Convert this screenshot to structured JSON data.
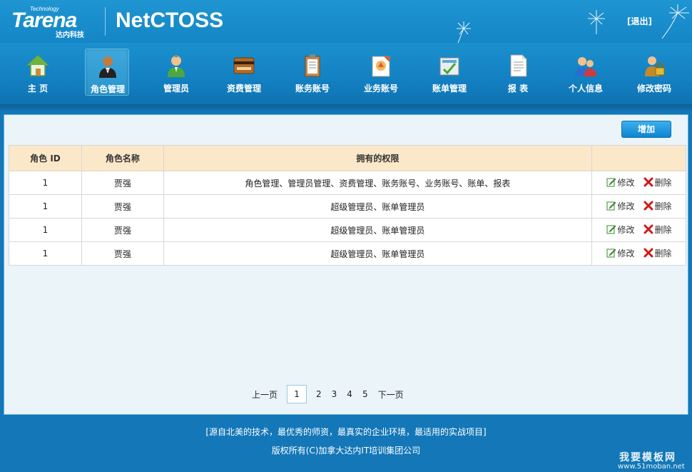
{
  "header": {
    "logo_small": "Technology",
    "logo_main": "Tarena",
    "logo_sub": "达内科技",
    "app_title": "NetCTOSS",
    "logout_label": "[退出]"
  },
  "nav": {
    "items": [
      {
        "label": "主  页",
        "icon": "home-icon"
      },
      {
        "label": "角色管理",
        "icon": "role-icon"
      },
      {
        "label": "管理员",
        "icon": "admin-icon"
      },
      {
        "label": "资费管理",
        "icon": "fee-icon"
      },
      {
        "label": "账务账号",
        "icon": "account-icon"
      },
      {
        "label": "业务账号",
        "icon": "service-account-icon"
      },
      {
        "label": "账单管理",
        "icon": "bill-icon"
      },
      {
        "label": "报  表",
        "icon": "report-icon"
      },
      {
        "label": "个人信息",
        "icon": "user-info-icon"
      },
      {
        "label": "修改密码",
        "icon": "password-icon"
      }
    ],
    "active_index": 1
  },
  "toolbar": {
    "add_label": "增加"
  },
  "table": {
    "headers": [
      "角色 ID",
      "角色名称",
      "拥有的权限",
      ""
    ],
    "rows": [
      {
        "id": "1",
        "name": "贾强",
        "perms": "角色管理、管理员管理、资费管理、账务账号、业务账号、账单、报表"
      },
      {
        "id": "1",
        "name": "贾强",
        "perms": "超级管理员、账单管理员"
      },
      {
        "id": "1",
        "name": "贾强",
        "perms": "超级管理员、账单管理员"
      },
      {
        "id": "1",
        "name": "贾强",
        "perms": "超级管理员、账单管理员"
      }
    ],
    "edit_label": "修改",
    "delete_label": "删除"
  },
  "pager": {
    "prev": "上一页",
    "pages": [
      "1",
      "2",
      "3",
      "4",
      "5"
    ],
    "current": "1",
    "next": "下一页"
  },
  "footer": {
    "line1": "[源自北美的技术，最优秀的师资，最真实的企业环境，最适用的实战项目]",
    "line2": "版权所有(C)加拿大达内IT培训集团公司"
  },
  "watermark": {
    "text": "我要模板网",
    "url": "www.51moban.net"
  },
  "colors": {
    "header": "#1f95d2",
    "nav": "#1380c2",
    "table_header": "#fbe8c8",
    "panel": "#eaf4f9",
    "add_button": "#0d85cf"
  }
}
